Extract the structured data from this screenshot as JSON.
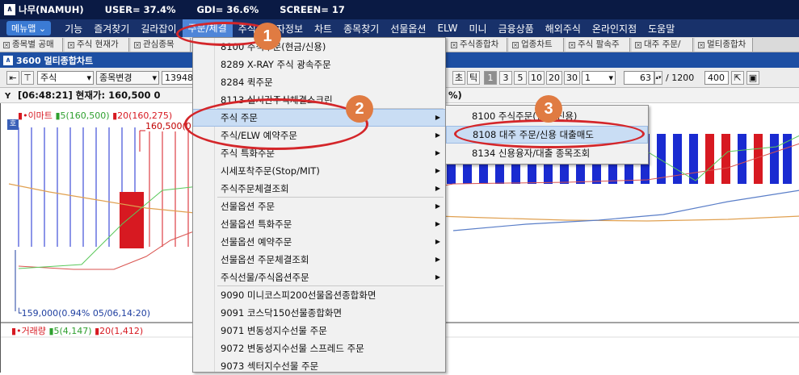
{
  "titlebar": {
    "app": "나무(NAMUH)",
    "user": "USER= 37.4%",
    "gdi": "GDI= 36.6%",
    "screen": "SCREEN= 17"
  },
  "menubar": {
    "menu_button": "메뉴맵",
    "items": [
      "기능",
      "즐겨찾기",
      "길라잡이",
      "주문/체결",
      "주식",
      "투자정보",
      "차트",
      "종목찾기",
      "선물옵션",
      "ELW",
      "미니",
      "금융상품",
      "해외주식",
      "온라인지점",
      "도움말"
    ]
  },
  "tabs": [
    "종목별 공매",
    "주식 현재가",
    "관심종목",
    "주식종합차",
    "업종차트",
    "주식 팔속주",
    "대주 주문/",
    "멀티종합차"
  ],
  "window": {
    "title": "3600 멀티종합차트"
  },
  "toolbar": {
    "market": "주식",
    "change_button": "종목변경",
    "code": "139480",
    "period_labels": [
      "초",
      "틱",
      "1",
      "3",
      "5",
      "10",
      "20",
      "30"
    ],
    "period_select": "1",
    "count_value": "63",
    "total": "/ 1200",
    "zoom": "400"
  },
  "infobar": {
    "text": "[06:48:21] 현재가: 160,500  0",
    "right_tail": "%)"
  },
  "chart": {
    "legend_price": {
      "name": "이마트",
      "ma5": "5(160,500)",
      "ma20": "20(160,275)"
    },
    "hover_label": "160,500(0",
    "min_label": "159,000(0.94% 05/06,14:20)",
    "side_button": "호",
    "legend_volume": {
      "name": "거래량",
      "ma5": "5(4,147)",
      "ma20": "20(1,412)"
    },
    "colors": {
      "up": "#d71921",
      "down": "#1a2bd1",
      "ma5": "#5bc85b",
      "ma20": "#d9534f",
      "ma60": "#e0a050",
      "ma120": "#5a7ec8"
    }
  },
  "menu_order": {
    "items": [
      {
        "label": "8100 주식주문(현금/신용)",
        "arrow": false
      },
      {
        "label": "8289 X-RAY 주식 광속주문",
        "arrow": false
      },
      {
        "label": "8284 퀵주문",
        "arrow": false
      },
      {
        "label": "8113 실시간주식체결소크린",
        "arrow": false
      },
      {
        "label": "주식 주문",
        "arrow": true
      },
      {
        "label": "주식/ELW 예약주문",
        "arrow": true
      },
      {
        "label": "주식 특화주문",
        "arrow": true
      },
      {
        "label": "시세포착주문(Stop/MIT)",
        "arrow": true
      },
      {
        "label": "주식주문체결조회",
        "arrow": true
      },
      {
        "label": "선물옵션 주문",
        "arrow": true
      },
      {
        "label": "선물옵션 특화주문",
        "arrow": true
      },
      {
        "label": "선물옵션 예약주문",
        "arrow": true
      },
      {
        "label": "선물옵션 주문체결조회",
        "arrow": true
      },
      {
        "label": "주식선물/주식옵션주문",
        "arrow": true
      },
      {
        "label": "9090 미니코스피200선물옵션종합화면",
        "arrow": false
      },
      {
        "label": "9091 코스닥150선물종합화면",
        "arrow": false
      },
      {
        "label": "9071 변동성지수선물 주문",
        "arrow": false
      },
      {
        "label": "9072 변동성지수선물 스프레드 주문",
        "arrow": false
      },
      {
        "label": "9073 섹터지수선물 주문",
        "arrow": false
      }
    ]
  },
  "submenu_stock_order": {
    "items": [
      "8100 주식주문(현금/신용)",
      "8108 대주 주문/신용 대출매도",
      "8134 신용융자/대출 종목조회"
    ]
  },
  "callouts": [
    "1",
    "2",
    "3"
  ]
}
